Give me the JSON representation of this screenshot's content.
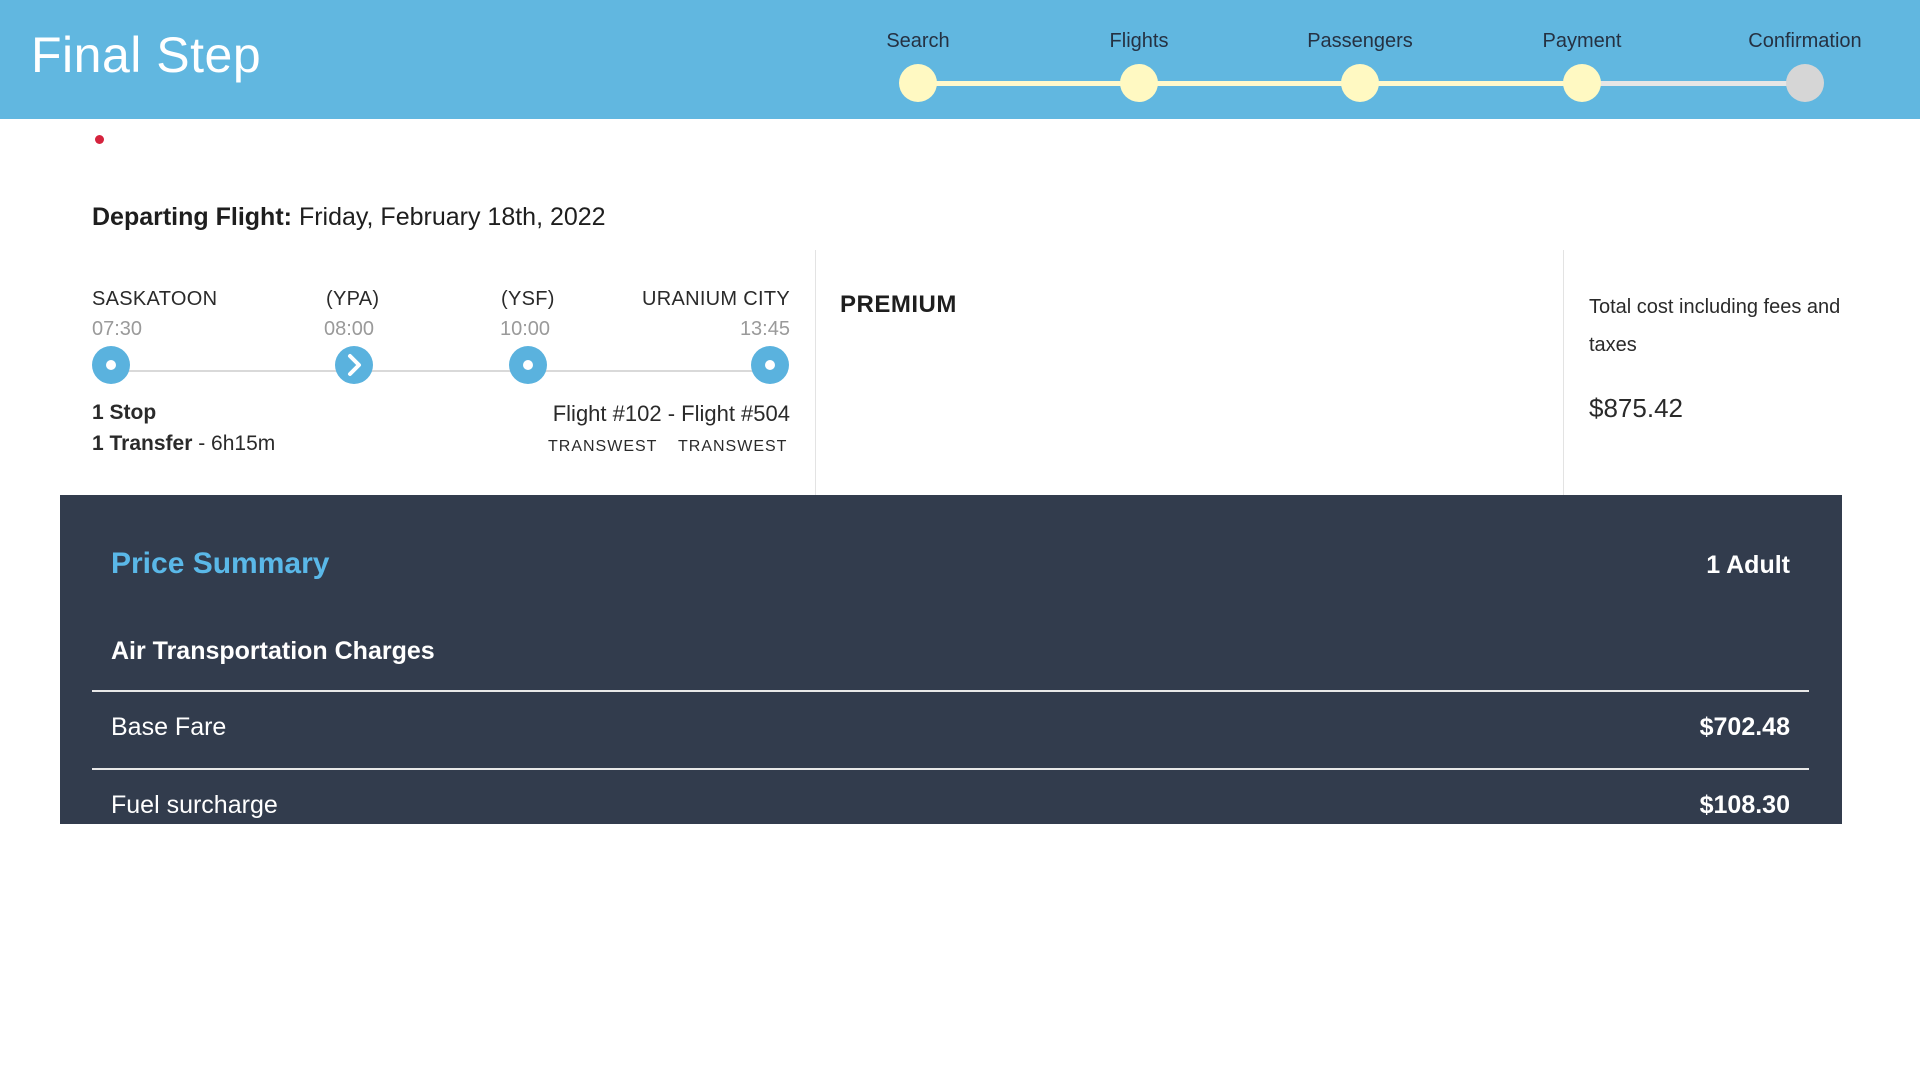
{
  "header": {
    "title": "Final Step",
    "steps": [
      {
        "label": "Search",
        "state": "complete"
      },
      {
        "label": "Flights",
        "state": "complete"
      },
      {
        "label": "Passengers",
        "state": "complete"
      },
      {
        "label": "Payment",
        "state": "complete"
      },
      {
        "label": "Confirmation",
        "state": "pending"
      }
    ],
    "progress_fraction": 0.75
  },
  "departing": {
    "label": "Departing Flight:",
    "date": "Friday, February 18th, 2022"
  },
  "route": {
    "stops": [
      {
        "city": "SASKATOON",
        "time": "07:30"
      },
      {
        "city": "(YPA)",
        "time": "08:00"
      },
      {
        "city": "(YSF)",
        "time": "10:00"
      },
      {
        "city": "URANIUM CITY",
        "time": "13:45"
      }
    ],
    "stops_text": "1 Stop",
    "transfer_bold": "1 Transfer",
    "transfer_rest": " - 6h15m",
    "flights": "Flight #102 - Flight #504",
    "airline_1": "TRANSWEST",
    "airline_2": "TRANSWEST"
  },
  "fare_class": "PREMIUM",
  "total": {
    "label": "Total cost including fees and taxes",
    "amount": "$875.42"
  },
  "price_summary": {
    "title": "Price Summary",
    "passengers": "1 Adult",
    "section": "Air Transportation Charges",
    "rows": [
      {
        "label": "Base Fare",
        "value": "$702.48"
      },
      {
        "label": "Fuel surcharge",
        "value": "$108.30"
      }
    ]
  },
  "colors": {
    "header_bg": "#61b7e0",
    "step_done": "#fff9c2",
    "step_pending": "#d6d6d6",
    "route_node": "#5ab2de",
    "panel_bg": "#323c4d",
    "panel_title": "#5ab8e8"
  },
  "icons": {
    "route_node": "circle-dot-icon",
    "route_transfer": "chevron-right-icon"
  }
}
